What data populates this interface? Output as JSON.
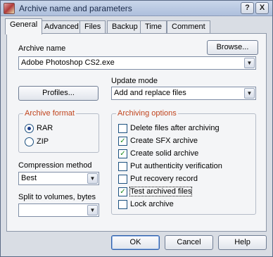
{
  "window": {
    "title": "Archive name and parameters",
    "help_button": "?",
    "close_button": "X"
  },
  "tabs": [
    {
      "label": "General",
      "active": true
    },
    {
      "label": "Advanced",
      "active": false
    },
    {
      "label": "Files",
      "active": false
    },
    {
      "label": "Backup",
      "active": false
    },
    {
      "label": "Time",
      "active": false
    },
    {
      "label": "Comment",
      "active": false
    }
  ],
  "archive_name": {
    "label": "Archive name",
    "browse_label": "Browse...",
    "value": "Adobe Photoshop CS2.exe"
  },
  "profiles": {
    "label": "Profiles..."
  },
  "update_mode": {
    "label": "Update mode",
    "value": "Add and replace files"
  },
  "archive_format": {
    "title": "Archive format",
    "options": [
      {
        "label": "RAR",
        "selected": true
      },
      {
        "label": "ZIP",
        "selected": false
      }
    ]
  },
  "compression": {
    "label": "Compression method",
    "value": "Best"
  },
  "split": {
    "label": "Split to volumes, bytes",
    "value": ""
  },
  "archiving_options": {
    "title": "Archiving options",
    "items": [
      {
        "label": "Delete files after archiving",
        "checked": false
      },
      {
        "label": "Create SFX archive",
        "checked": true
      },
      {
        "label": "Create solid archive",
        "checked": true
      },
      {
        "label": "Put authenticity verification",
        "checked": false
      },
      {
        "label": "Put recovery record",
        "checked": false
      },
      {
        "label": "Test archived files",
        "checked": true
      },
      {
        "label": "Lock archive",
        "checked": false
      }
    ]
  },
  "footer": {
    "ok_label": "OK",
    "cancel_label": "Cancel",
    "help_label": "Help"
  },
  "icons": {
    "combo_arrow": "chevron-down-icon",
    "check": "checkmark-icon"
  },
  "colors": {
    "group_title": "#c0441d",
    "checkmark": "#1c8a1c"
  }
}
